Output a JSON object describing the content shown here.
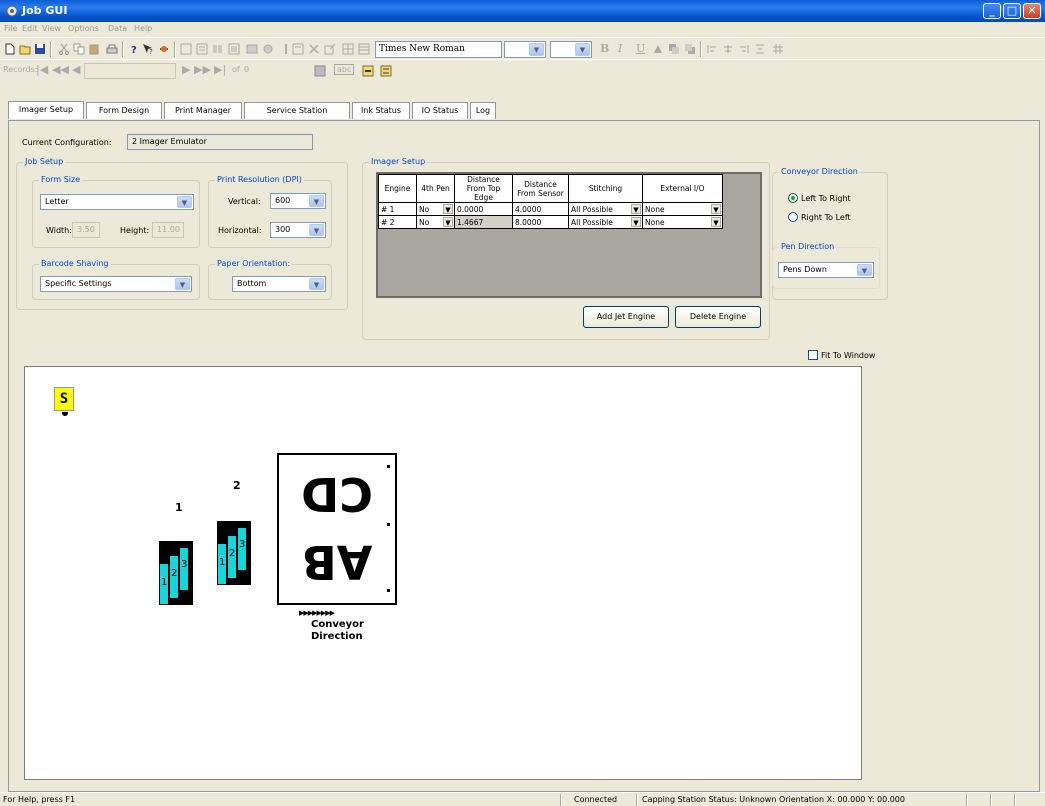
{
  "window": {
    "title": "Job GUI"
  },
  "menu": [
    "File",
    "Edit",
    "View",
    "Options",
    "Data",
    "Help"
  ],
  "toolbar2": {
    "records_label": "Records:",
    "of_label": "of",
    "record_count": "0",
    "abc_label": "abc"
  },
  "font_combo": {
    "value": "Times New Roman"
  },
  "format_buttons": {
    "bold": "B",
    "italic": "I",
    "underline": "U"
  },
  "tabs": [
    "Imager Setup",
    "Form Design",
    "Print Manager",
    "Service Station",
    "Ink Status",
    "IO Status",
    "Log"
  ],
  "current_config": {
    "label": "Current Configuration:",
    "value": "2 Imager Emulator"
  },
  "job_setup": {
    "title": "Job Setup",
    "form_size": {
      "title": "Form Size",
      "value": "Letter",
      "width_label": "Width:",
      "width": "3.50",
      "height_label": "Height:",
      "height": "11.00"
    },
    "print_resolution": {
      "title": "Print Resolution (DPI)",
      "vertical_label": "Vertical:",
      "vertical": "600",
      "horizontal_label": "Horizontal:",
      "horizontal": "300"
    },
    "barcode_shaving": {
      "title": "Barcode Shaving",
      "value": "Specific Settings"
    },
    "paper_orientation": {
      "title": "Paper Orientation:",
      "value": "Bottom"
    }
  },
  "imager_setup": {
    "title": "Imager Setup",
    "columns": [
      "Engine",
      "4th Pen",
      "Distance From Top Edge",
      "Distance From Sensor",
      "Stitching",
      "External I/O"
    ],
    "rows": [
      [
        "# 1",
        "No",
        "0.0000",
        "4.0000",
        "All Possible",
        "None"
      ],
      [
        "# 2",
        "No",
        "1.4667",
        "8.0000",
        "All Possible",
        "None"
      ]
    ],
    "add_button": "Add Jet Engine",
    "delete_button": "Delete Engine"
  },
  "conveyor_direction": {
    "title": "Conveyor Direction",
    "options": [
      "Left To Right",
      "Right To Left"
    ],
    "selected": "Left To Right"
  },
  "pen_direction": {
    "title": "Pen Direction",
    "value": "Pens Down"
  },
  "fit_to_window": "Fit To Window",
  "canvas": {
    "s_marker": "S",
    "engine1_label": "1",
    "engine2_label": "2",
    "pen_labels": [
      "1",
      "2",
      "3"
    ],
    "form_text_top": "CD",
    "form_text_bottom": "AB",
    "arrows": "▶▶▶▶▶▶▶▶",
    "conveyor_label_1": "Conveyor",
    "conveyor_label_2": "Direction"
  },
  "status": {
    "help": "For Help, press F1",
    "connected": "Connected",
    "info": "Capping Station Status: Unknown  Orientation  X: 00.000  Y: 00.000"
  },
  "colors": {
    "titlebar": "#0a5fd8",
    "pen": "#19d4d8",
    "s_marker": "#ffff00",
    "group_title": "#0046d5"
  }
}
